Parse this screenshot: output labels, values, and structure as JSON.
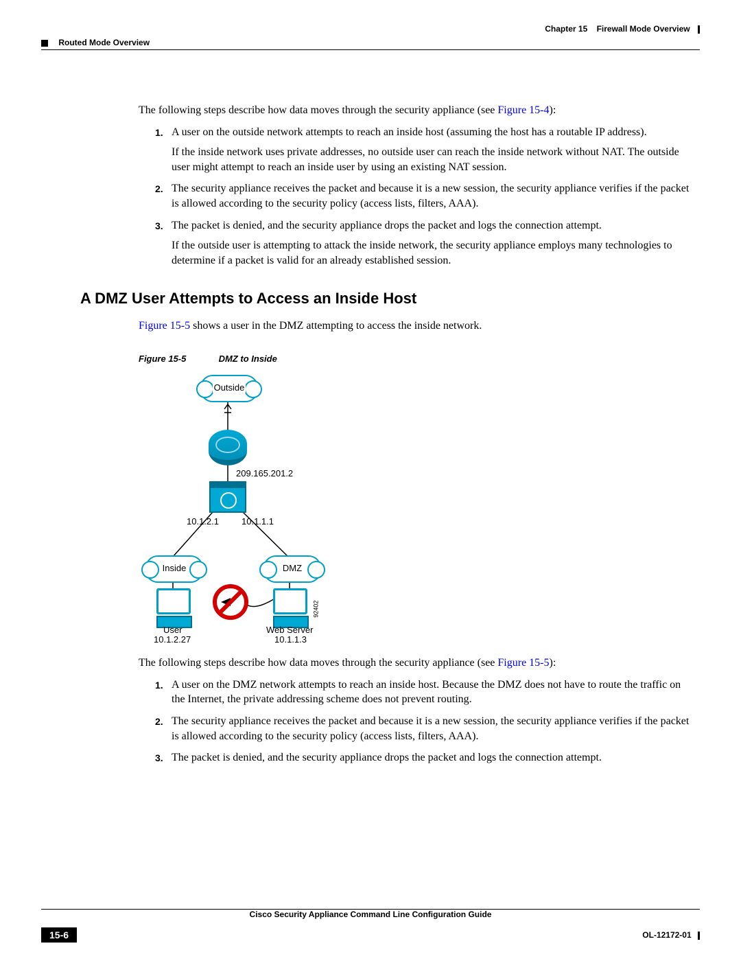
{
  "header": {
    "left_marker": "■",
    "section": "Routed Mode Overview",
    "chapter_label": "Chapter 15",
    "chapter_title": "Firewall Mode Overview"
  },
  "intro1": {
    "text_a": "The following steps describe how data moves through the security appliance (see ",
    "ref": "Figure 15-4",
    "text_b": "):"
  },
  "steps1": [
    {
      "num": "1.",
      "body": "A user on the outside network attempts to reach an inside host (assuming the host has a routable IP address).",
      "sub": "If the inside network uses private addresses, no outside user can reach the inside network without NAT. The outside user might attempt to reach an inside user by using an existing NAT session."
    },
    {
      "num": "2.",
      "body": "The security appliance receives the packet and because it is a new session, the security appliance verifies if the packet is allowed according to the security policy (access lists, filters, AAA)."
    },
    {
      "num": "3.",
      "body": "The packet is denied, and the security appliance drops the packet and logs the connection attempt.",
      "sub": "If the outside user is attempting to attack the inside network, the security appliance employs many technologies to determine if a packet is valid for an already established session."
    }
  ],
  "heading2": "A DMZ User Attempts to Access an Inside Host",
  "intro2": {
    "ref": "Figure 15-5",
    "text": " shows a user in the DMZ attempting to access the inside network."
  },
  "figure": {
    "label": "Figure 15-5",
    "title": "DMZ to Inside",
    "outside": "Outside",
    "inside": "Inside",
    "dmz": "DMZ",
    "ip_top": "209.165.201.2",
    "ip_left": "10.1.2.1",
    "ip_right": "10.1.1.1",
    "user_label": "User",
    "user_ip": "10.1.2.27",
    "ws_label": "Web Server",
    "ws_ip": "10.1.1.3",
    "side_num": "92402"
  },
  "intro3": {
    "text_a": "The following steps describe how data moves through the security appliance (see ",
    "ref": "Figure 15-5",
    "text_b": "):"
  },
  "steps2": [
    {
      "num": "1.",
      "body": "A user on the DMZ network attempts to reach an inside host. Because the DMZ does not have to route the traffic on the Internet, the private addressing scheme does not prevent routing."
    },
    {
      "num": "2.",
      "body": "The security appliance receives the packet and because it is a new session, the security appliance verifies if the packet is allowed according to the security policy (access lists, filters, AAA)."
    },
    {
      "num": "3.",
      "body": "The packet is denied, and the security appliance drops the packet and logs the connection attempt."
    }
  ],
  "footer": {
    "title": "Cisco Security Appliance Command Line Configuration Guide",
    "page": "15-6",
    "doc_id": "OL-12172-01"
  }
}
